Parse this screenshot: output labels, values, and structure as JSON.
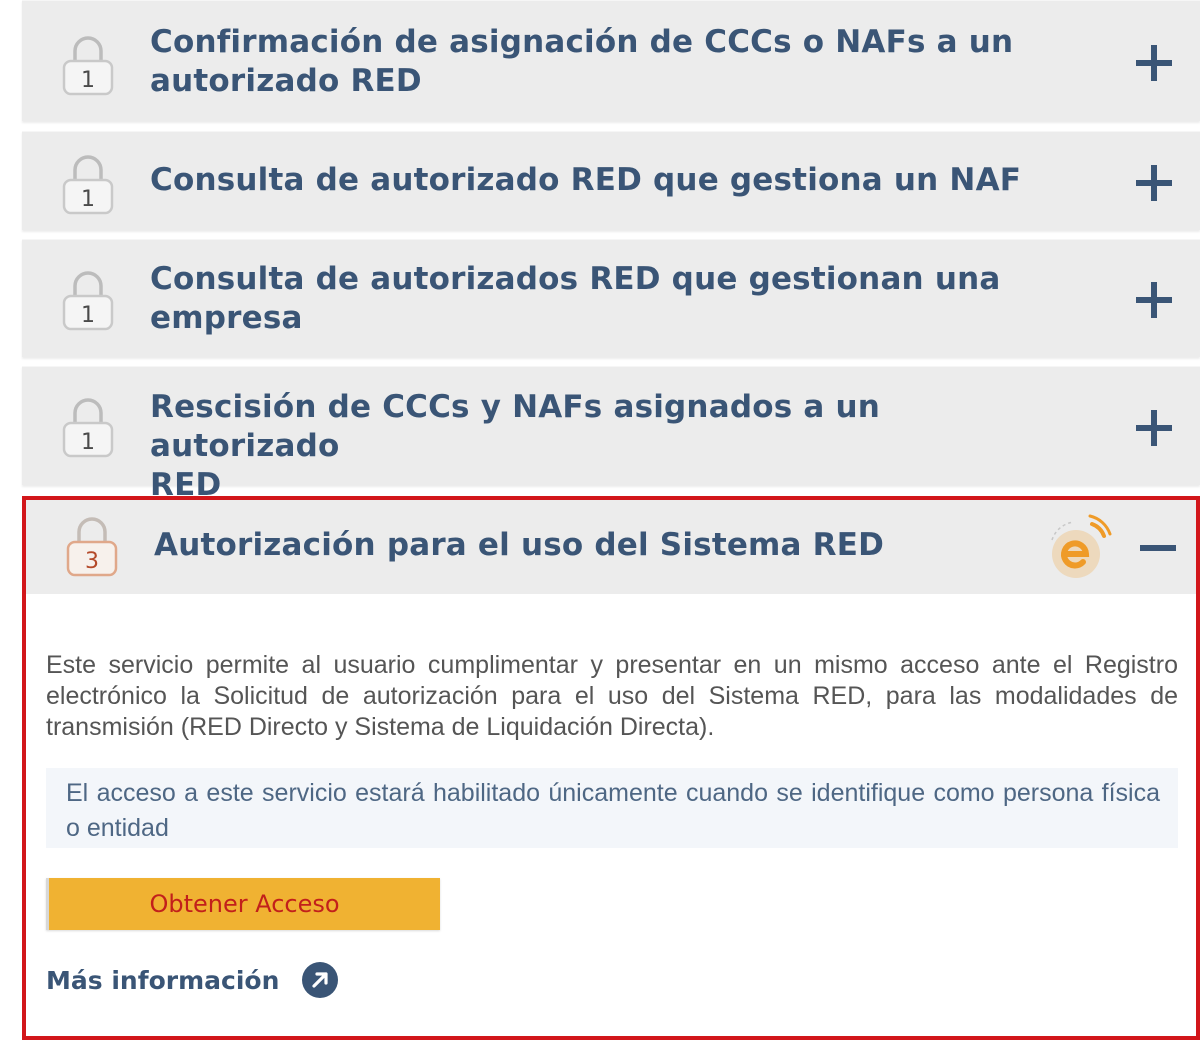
{
  "colors": {
    "title_text": "#3a5576",
    "panel_bg": "#ececec",
    "highlight_border": "#d2161a",
    "button_bg": "#f0b232",
    "button_text": "#c2201b",
    "logo_orange": "#f0a030"
  },
  "panels": [
    {
      "level": "1",
      "title_lines": [
        "Confirmación de asignación de CCCs o NAFs a un",
        "autorizado RED"
      ],
      "icon": "lock-icon",
      "toggle": "plus-icon"
    },
    {
      "level": "1",
      "title_lines": [
        "Consulta de autorizado RED que gestiona un NAF"
      ],
      "icon": "lock-icon",
      "toggle": "plus-icon"
    },
    {
      "level": "1",
      "title_lines": [
        "Consulta de autorizados RED que gestionan una",
        "empresa"
      ],
      "icon": "lock-icon",
      "toggle": "plus-icon"
    },
    {
      "level": "1",
      "title_lines": [
        "Rescisión de CCCs y NAFs asignados a un autorizado",
        "RED"
      ],
      "icon": "lock-icon",
      "toggle": "plus-icon"
    }
  ],
  "expanded": {
    "level": "3",
    "title": "Autorización para el uso del Sistema RED",
    "logo_icon": "sistema-red-logo-icon",
    "toggle": "minus-icon",
    "description": "Este servicio permite al usuario cumplimentar y presentar en un mismo acceso ante el Registro electrónico la Solicitud de autorización para el uso del Sistema RED, para las modalidades de transmisión (RED Directo y Sistema de Liquidación Directa).",
    "notice": "El acceso a este servicio estará habilitado únicamente cuando se identifique como persona física o entidad",
    "access_button": "Obtener Acceso",
    "more_info": "Más información",
    "more_info_icon": "external-arrow-icon"
  }
}
